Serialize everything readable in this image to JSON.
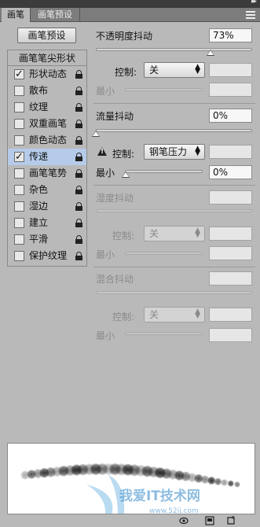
{
  "tabs": [
    {
      "label": "画笔",
      "active": true
    },
    {
      "label": "画笔预设",
      "active": false
    }
  ],
  "preset_button": "画笔预设",
  "left_panel": {
    "header": "画笔笔尖形状",
    "items": [
      {
        "label": "形状动态",
        "checked": true,
        "selected": false
      },
      {
        "label": "散布",
        "checked": false,
        "selected": false
      },
      {
        "label": "纹理",
        "checked": false,
        "selected": false
      },
      {
        "label": "双重画笔",
        "checked": false,
        "selected": false
      },
      {
        "label": "颜色动态",
        "checked": false,
        "selected": false
      },
      {
        "label": "传递",
        "checked": true,
        "selected": true
      },
      {
        "label": "画笔笔势",
        "checked": false,
        "selected": false
      },
      {
        "label": "杂色",
        "checked": false,
        "selected": false
      },
      {
        "label": "湿边",
        "checked": false,
        "selected": false
      },
      {
        "label": "建立",
        "checked": false,
        "selected": false
      },
      {
        "label": "平滑",
        "checked": false,
        "selected": false
      },
      {
        "label": "保护纹理",
        "checked": false,
        "selected": false
      }
    ]
  },
  "opacity_jitter": {
    "label": "不透明度抖动",
    "value": "73%",
    "slider": 0.73,
    "control_label": "控制:",
    "control_value": "关",
    "min_label": "最小"
  },
  "flow_jitter": {
    "label": "流量抖动",
    "value": "0%",
    "slider": 0.0,
    "control_label": "控制:",
    "control_value": "钢笔压力",
    "min_label": "最小",
    "min_value": "0%",
    "min_slider": 0.0
  },
  "wetness_jitter": {
    "label": "湿度抖动",
    "control_label": "控制:",
    "control_value": "关",
    "min_label": "最小"
  },
  "mix_jitter": {
    "label": "混合抖动",
    "control_label": "控制:",
    "control_value": "关",
    "min_label": "最小"
  },
  "icons": [
    "lock-icon",
    "warning-icon",
    "panel-menu-icon",
    "toggle-preview-icon",
    "create-new-brush-icon",
    "new-brush-icon"
  ],
  "watermark": "我爱IT技术网 www.52ij.com",
  "colors": {
    "panel_bg": "#b9b9b9",
    "selected_item": "#b5cbe9",
    "title_bar": "#3c3c3c"
  }
}
